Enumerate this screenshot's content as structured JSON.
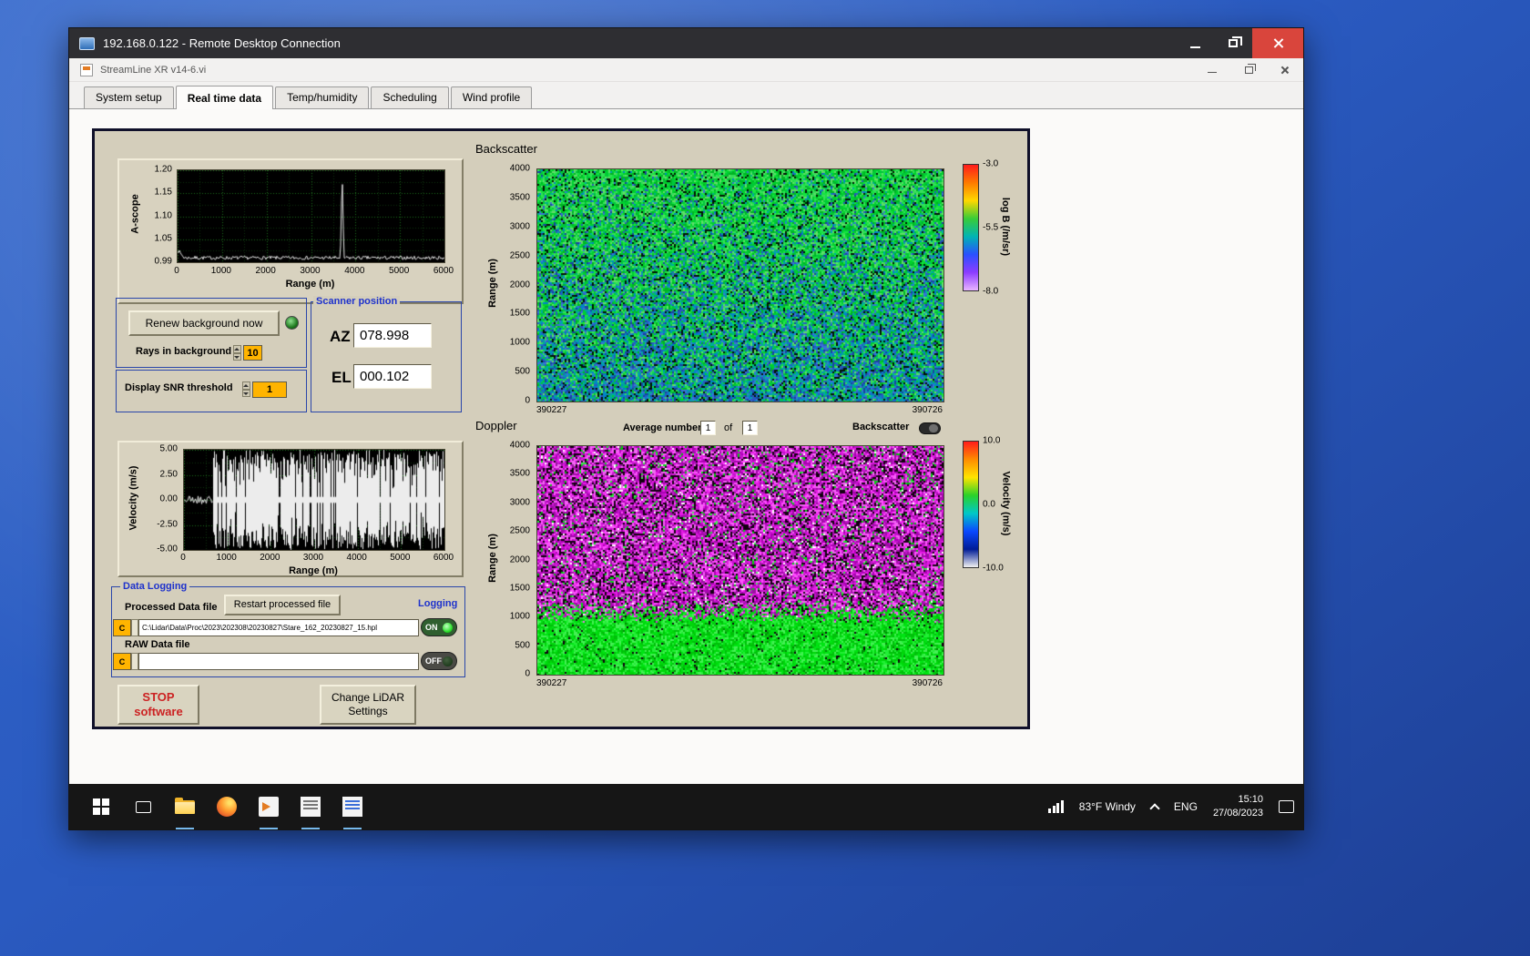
{
  "rdp_window": {
    "title": "192.168.0.122 - Remote Desktop Connection"
  },
  "app_window": {
    "title": "StreamLine XR v14-6.vi",
    "tabs": [
      {
        "label": "System setup"
      },
      {
        "label": "Real time data"
      },
      {
        "label": "Temp/humidity"
      },
      {
        "label": "Scheduling"
      },
      {
        "label": "Wind profile"
      }
    ]
  },
  "background_controls": {
    "renew_button_label": "Renew background now",
    "rays_label": "Rays in background",
    "rays_value": "10",
    "snr_label": "Display SNR threshold",
    "snr_value": "1"
  },
  "scanner_position": {
    "title": "Scanner position",
    "az_label": "AZ",
    "az_value": "078.998",
    "el_label": "EL",
    "el_value": "000.102"
  },
  "doppler_header": {
    "avg_label": "Average number",
    "avg_value": "1",
    "of_label": "of",
    "avg_total": "1",
    "toggle_label": "Backscatter"
  },
  "data_logging": {
    "title": "Data Logging",
    "processed_label": "Processed Data file",
    "restart_button_label": "Restart processed file",
    "logging_label": "Logging",
    "drive_label": "C",
    "processed_path": "C:\\Lidar\\Data\\Proc\\2023\\202308\\20230827\\Stare_162_20230827_15.hpl",
    "on_label": "ON",
    "raw_label": "RAW Data file",
    "raw_path": "",
    "off_label": "OFF"
  },
  "footer_buttons": {
    "stop_line1": "STOP",
    "stop_line2": "software",
    "change_line1": "Change LiDAR",
    "change_line2": "Settings"
  },
  "taskbar": {
    "weather": "83°F Windy",
    "language": "ENG",
    "time": "15:10",
    "date": "27/08/2023"
  },
  "chart_data": [
    {
      "type": "line",
      "title": "A-scope",
      "ylabel": "A-scope",
      "xlabel": "Range (m)",
      "xlim": [
        0,
        6000
      ],
      "ylim": [
        0.99,
        1.2
      ],
      "xticks": [
        "0",
        "1000",
        "2000",
        "3000",
        "4000",
        "5000",
        "6000"
      ],
      "yticks": [
        "1.20",
        "1.15",
        "1.10",
        "1.05",
        "0.99"
      ],
      "bg": "#000000",
      "grid_color": "#1c6e1c",
      "line_color": "#e6e6e6",
      "baseline": 1.0,
      "noise": 0.004,
      "spike_x": 3700,
      "spike_top": 1.2,
      "seed": 7
    },
    {
      "type": "bars",
      "ylabel": "Velocity (m/s)",
      "xlabel": "Range (m)",
      "xlim": [
        0,
        6000
      ],
      "ylim": [
        -5,
        5
      ],
      "xticks": [
        "0",
        "1000",
        "2000",
        "3000",
        "4000",
        "5000",
        "6000"
      ],
      "yticks": [
        "5.00",
        "2.50",
        "0.00",
        "-2.50",
        "-5.00"
      ],
      "bg": "#000000",
      "grid_color": "#1c6e1c",
      "line_color": "#ececec",
      "quiet_until_x": 650,
      "gap_probability": 0.1,
      "seed": 21
    },
    {
      "type": "heatmap",
      "style": "backscatter",
      "title": "Backscatter",
      "ylabel": "Range (m)",
      "ylim": [
        0,
        4000
      ],
      "yticks": [
        "4000",
        "3500",
        "3000",
        "2500",
        "2000",
        "1500",
        "1000",
        "500",
        "0"
      ],
      "x_start_label": "390227",
      "x_end_label": "390726",
      "palette_primary": [
        "#00d22c",
        "#16e440",
        "#00b424",
        "#36de5a",
        "#00c63c",
        "#62dc6a"
      ],
      "palette_secondary": [
        "#00a4ae",
        "#0282c8",
        "#2a58c0",
        "#1a42a2",
        "#00ae8e",
        "#3a72d8"
      ],
      "speckle_color": "#001402",
      "seed": 101,
      "colorbar": {
        "label": "log B (/m/sr)",
        "ticks": [
          "-3.0",
          "-5.5",
          "-8.0"
        ],
        "colors": [
          "#ff1c1c",
          "#ff7a00",
          "#ffd800",
          "#38cc38",
          "#00b4b4",
          "#2a50ff",
          "#8c3cff",
          "#e8b4ff"
        ]
      }
    },
    {
      "type": "heatmap",
      "style": "doppler",
      "title": "Doppler",
      "ylabel": "Range (m)",
      "ylim": [
        0,
        4000
      ],
      "yticks": [
        "4000",
        "3500",
        "3000",
        "2500",
        "2000",
        "1500",
        "1000",
        "500",
        "0"
      ],
      "x_start_label": "390227",
      "x_end_label": "390726",
      "palette_primary": [
        "#e61ae6",
        "#ff4cff",
        "#c214cc",
        "#9a12a0",
        "#f06cf0",
        "#ac00b4"
      ],
      "palette_secondary": [
        "#00e414",
        "#22ee36",
        "#00d60a",
        "#44f054",
        "#00c00a"
      ],
      "speckle_color": "#12000f",
      "split": 0.67,
      "fade": 0.1,
      "seed": 202,
      "colorbar": {
        "label": "Velocity (m/s)",
        "ticks": [
          "10.0",
          "0.0",
          "-10.0"
        ],
        "colors": [
          "#ff1c1c",
          "#ff8c00",
          "#ffe400",
          "#2ad22a",
          "#00c8c8",
          "#0a48ff",
          "#001c96",
          "#f2f2f2"
        ]
      }
    }
  ]
}
